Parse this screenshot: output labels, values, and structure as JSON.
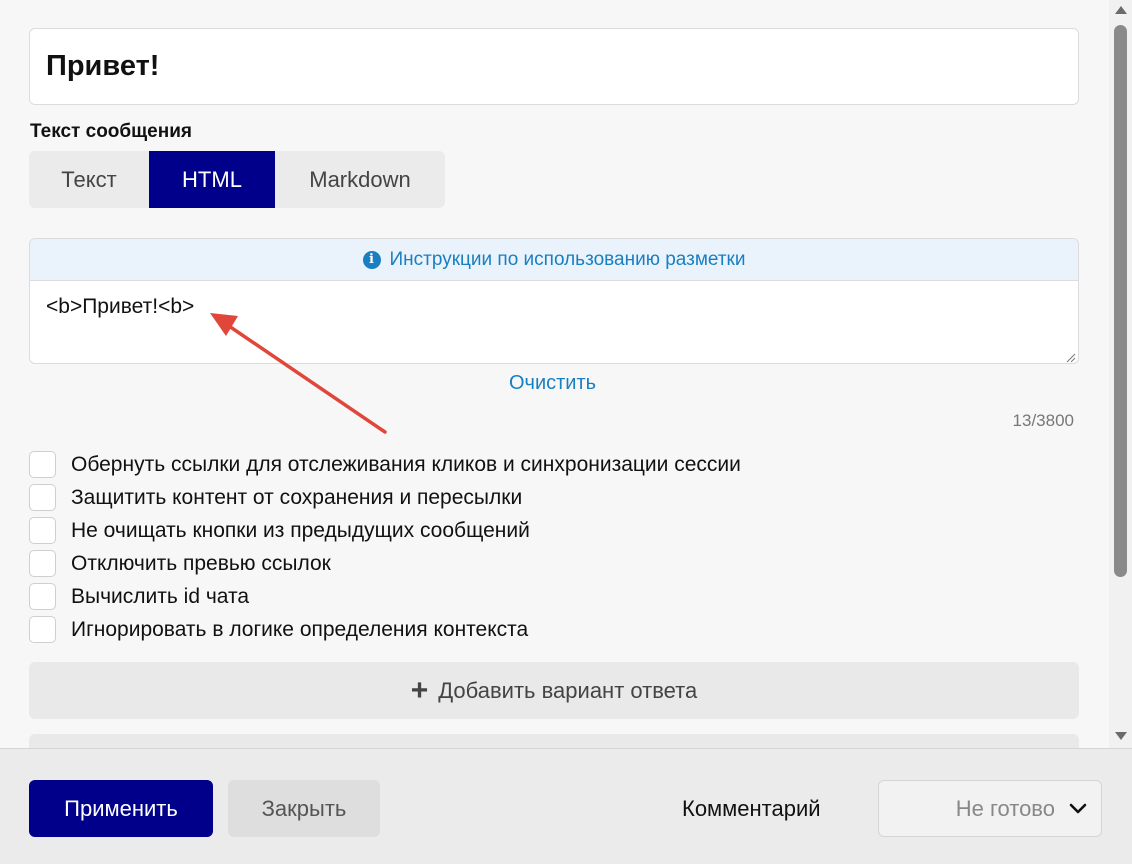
{
  "preview": {
    "text": "Привет!"
  },
  "message_section": {
    "label": "Текст сообщения"
  },
  "format_tabs": [
    {
      "label": "Текст",
      "active": false
    },
    {
      "label": "HTML",
      "active": true
    },
    {
      "label": "Markdown",
      "active": false
    }
  ],
  "editor": {
    "instructions": "Инструкции по использованию разметки",
    "value": "<b>Привет!<b>"
  },
  "clear_label": "Очистить",
  "counter": "13/3800",
  "options": [
    {
      "label": "Обернуть ссылки для отслеживания кликов и синхронизации сессии",
      "checked": false
    },
    {
      "label": "Защитить контент от сохранения и пересылки",
      "checked": false
    },
    {
      "label": "Не очищать кнопки из предыдущих сообщений",
      "checked": false
    },
    {
      "label": "Отключить превью ссылок",
      "checked": false
    },
    {
      "label": "Вычислить id чата",
      "checked": false
    },
    {
      "label": "Игнорировать в логике определения контекста",
      "checked": false
    }
  ],
  "add_answer_label": "Добавить вариант ответа",
  "footer": {
    "apply_label": "Применить",
    "close_label": "Закрыть",
    "comment_label": "Комментарий",
    "status_value": "Не готово"
  },
  "colors": {
    "primary": "#00008b",
    "link": "#1a7fc1",
    "annotation_arrow": "#e0463a"
  }
}
